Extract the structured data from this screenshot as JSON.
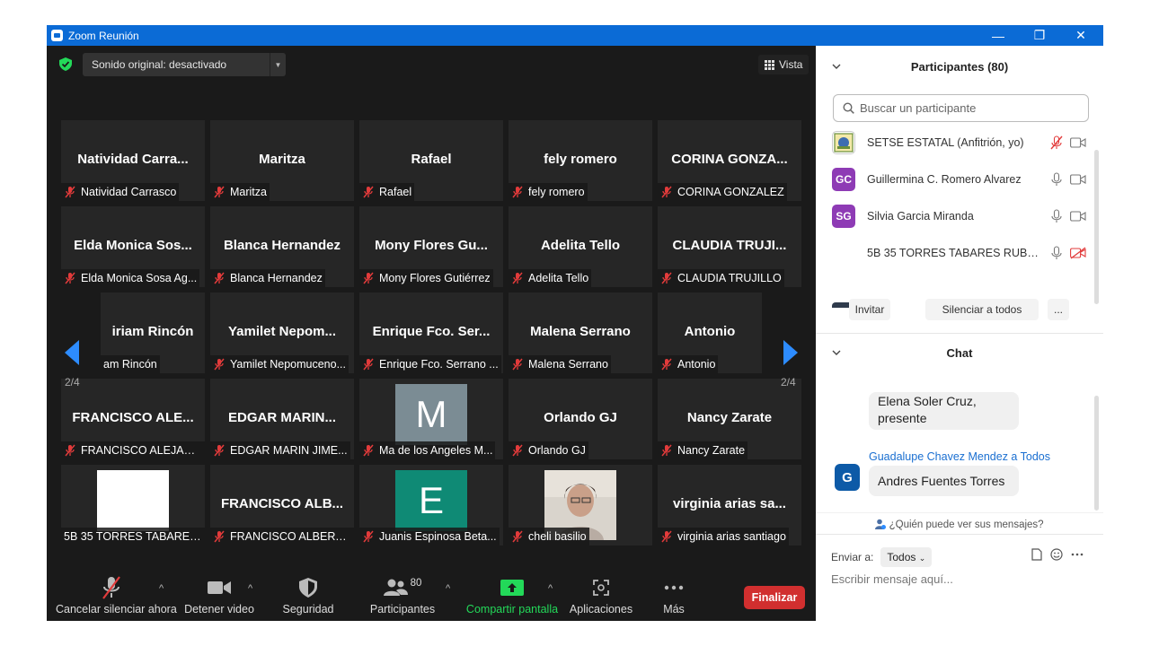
{
  "window": {
    "title": "Zoom Reunión",
    "minimize_glyph": "—",
    "restore_glyph": "❐",
    "close_glyph": "✕"
  },
  "top": {
    "sound_button": "Sonido original: desactivado",
    "view_button": "Vista"
  },
  "tiles": [
    {
      "name": "Natividad  Carra...",
      "label": "Natividad Carrasco",
      "muted": true
    },
    {
      "name": "Maritza",
      "label": "Maritza",
      "muted": true
    },
    {
      "name": "Rafael",
      "label": "Rafael",
      "muted": true
    },
    {
      "name": "fely  romero",
      "label": "fely  romero",
      "muted": true
    },
    {
      "name": "CORINA  GONZA...",
      "label": "CORINA GONZALEZ",
      "muted": true
    },
    {
      "name": "Elda  Monica  Sos...",
      "label": "Elda Monica Sosa Ag...",
      "muted": true
    },
    {
      "name": "Blanca Hernandez",
      "label": "Blanca Hernandez",
      "muted": true
    },
    {
      "name": "Mony  Flores  Gu...",
      "label": "Mony Flores Gutiérrez",
      "muted": true
    },
    {
      "name": "Adelita Tello",
      "label": "Adelita Tello",
      "muted": true
    },
    {
      "name": "CLAUDIA  TRUJI...",
      "label": "CLAUDIA TRUJILLO",
      "muted": true
    },
    {
      "name": "iriam Rincón",
      "label": "am Rincón",
      "muted": false
    },
    {
      "name": "Yamilet  Nepom...",
      "label": "Yamilet Nepomuceno...",
      "muted": true
    },
    {
      "name": "Enrique  Fco.  Ser...",
      "label": "Enrique Fco. Serrano ...",
      "muted": true
    },
    {
      "name": "Malena Serrano",
      "label": "Malena Serrano",
      "muted": true
    },
    {
      "name": "Antonio",
      "label": "Antonio",
      "muted": true
    },
    {
      "name": "FRANCISCO  ALE...",
      "label": "FRANCISCO ALEJAND...",
      "muted": true
    },
    {
      "name": "EDGAR  MARIN...",
      "label": "EDGAR MARIN JIME...",
      "muted": true
    },
    {
      "name": "",
      "label": "Ma de los Angeles M...",
      "muted": true,
      "avatar_letter": "M",
      "avatar_color": "#7b8c94"
    },
    {
      "name": "Orlando GJ",
      "label": "Orlando GJ",
      "muted": true
    },
    {
      "name": "Nancy Zarate",
      "label": "Nancy Zarate",
      "muted": true
    },
    {
      "name": "",
      "label": "5B 35 TORRES TABARES ...",
      "muted": false,
      "avatar_color": "#ffffff"
    },
    {
      "name": "FRANCISCO  ALB...",
      "label": "FRANCISCO ALBERTO...",
      "muted": true
    },
    {
      "name": "",
      "label": "Juanis Espinosa Beta...",
      "muted": true,
      "avatar_letter": "E",
      "avatar_color": "#0f8a75"
    },
    {
      "name": "",
      "label": "cheli basilio",
      "muted": true,
      "photo": true
    },
    {
      "name": "virginia  arias  sa...",
      "label": "virginia arias santiago",
      "muted": true
    }
  ],
  "pagination": {
    "left": "2/4",
    "right": "2/4"
  },
  "toolbar": {
    "unmute": "Cancelar silenciar ahora",
    "video": "Detener video",
    "security": "Seguridad",
    "participants": "Participantes",
    "participants_count": "80",
    "share": "Compartir pantalla",
    "apps": "Aplicaciones",
    "more": "Más",
    "end": "Finalizar"
  },
  "participants_panel": {
    "title": "Participantes (80)",
    "search_placeholder": "Buscar un participante",
    "rows": [
      {
        "initials": "",
        "name": "SETSE ESTATAL (Anfitrión, yo)",
        "color": "#ffffff",
        "mic": "muted",
        "video": "on"
      },
      {
        "initials": "GC",
        "name": "Guillermina C. Romero Alvarez",
        "color": "#8e3bb5",
        "mic": "on",
        "video": "on"
      },
      {
        "initials": "SG",
        "name": "Silvia Garcia Miranda",
        "color": "#8e3bb5",
        "mic": "on",
        "video": "on"
      },
      {
        "initials": "",
        "name": "5B 35 TORRES TABARES RUBEN ...",
        "color": "#ffffff",
        "mic": "on",
        "video": "off"
      }
    ],
    "invite": "Invitar",
    "mute_all": "Silenciar a todos",
    "more": "..."
  },
  "chat": {
    "title": "Chat",
    "prev_message": "Elena Soler Cruz,\npresente",
    "from": "Guadalupe Chavez Mendez a Todos",
    "from_initial": "G",
    "message": "Andres Fuentes Torres",
    "who_can_see": "¿Quién puede ver sus mensajes?",
    "send_to_label": "Enviar a:",
    "send_to_value": "Todos",
    "input_placeholder": "Escribir mensaje aquí..."
  }
}
